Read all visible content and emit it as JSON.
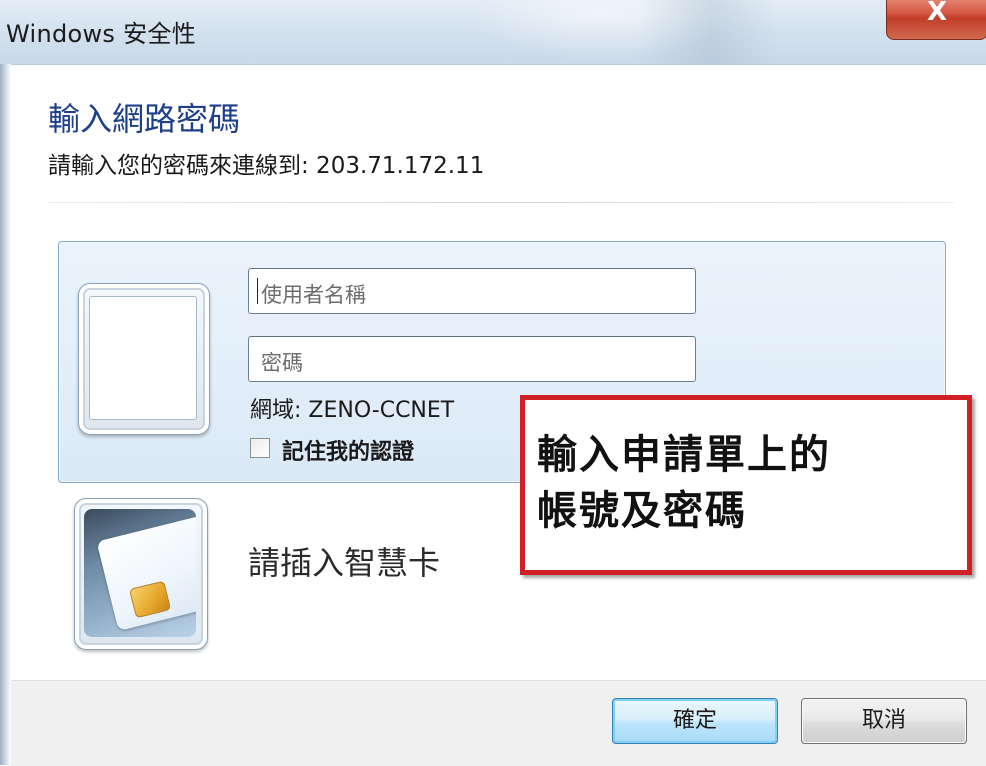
{
  "window": {
    "title": "Windows 安全性",
    "close_label": "X"
  },
  "dialog": {
    "heading": "輸入網路密碼",
    "subheading": "請輸入您的密碼來連線到: 203.71.172.11"
  },
  "credentials": {
    "username_placeholder": "使用者名稱",
    "password_placeholder": "密碼",
    "domain_label": "網域: ZENO-CCNET",
    "remember_label": "記住我的認證",
    "remember_checked": false
  },
  "smartcard": {
    "label": "請插入智慧卡"
  },
  "annotation": {
    "line1": "輸入申請單上的",
    "line2": "帳號及密碼",
    "border_color": "#d11f26"
  },
  "footer": {
    "ok_label": "確定",
    "cancel_label": "取消"
  },
  "colors": {
    "heading": "#1e3f8a",
    "tile_border": "#7ea8d4",
    "close_button": "#c13d28"
  }
}
